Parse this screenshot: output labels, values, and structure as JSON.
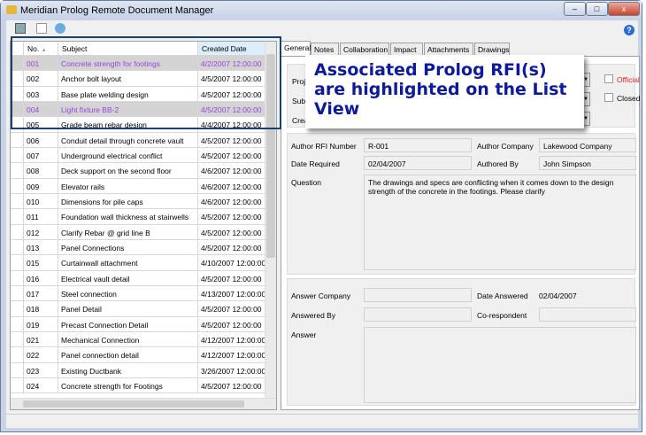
{
  "window": {
    "title": "Meridian Prolog Remote Document Manager",
    "minimize": "–",
    "maximize": "□",
    "close": "x"
  },
  "toolbar": {
    "icons": [
      "save-icon",
      "report-icon",
      "refresh-icon"
    ],
    "help": "?"
  },
  "list": {
    "columns": [
      "No.",
      "Subject",
      "Created Date"
    ],
    "rows": [
      {
        "no": "001",
        "subject": "Concrete strength for footings",
        "date": "4/2/2007 12:00:00",
        "highlighted": true
      },
      {
        "no": "002",
        "subject": "Anchor bolt layout",
        "date": "4/5/2007 12:00:00"
      },
      {
        "no": "003",
        "subject": "Base plate welding design",
        "date": "4/5/2007 12:00:00"
      },
      {
        "no": "004",
        "subject": "Light fixture BB-2",
        "date": "4/5/2007 12:00:00",
        "highlighted": true
      },
      {
        "no": "005",
        "subject": "Grade beam rebar design",
        "date": "4/4/2007 12:00:00"
      },
      {
        "no": "006",
        "subject": "Conduit detail through concrete vault",
        "date": "4/5/2007 12:00:00"
      },
      {
        "no": "007",
        "subject": "Underground electrical conflict",
        "date": "4/5/2007 12:00:00"
      },
      {
        "no": "008",
        "subject": "Deck support on the second floor",
        "date": "4/6/2007 12:00:00"
      },
      {
        "no": "009",
        "subject": "Elevator rails",
        "date": "4/6/2007 12:00:00"
      },
      {
        "no": "010",
        "subject": "Dimensions for pile caps",
        "date": "4/6/2007 12:00:00"
      },
      {
        "no": "011",
        "subject": "Foundation wall thickness at stairwells",
        "date": "4/5/2007 12:00:00"
      },
      {
        "no": "012",
        "subject": "Clarify Rebar @ grid line B",
        "date": "4/5/2007 12:00:00"
      },
      {
        "no": "013",
        "subject": "Panel Connections",
        "date": "4/5/2007 12:00:00"
      },
      {
        "no": "015",
        "subject": "Curtainwall attachment",
        "date": "4/10/2007 12:00:00"
      },
      {
        "no": "016",
        "subject": "Electrical vault detail",
        "date": "4/5/2007 12:00:00"
      },
      {
        "no": "017",
        "subject": "Steel connection",
        "date": "4/13/2007 12:00:00"
      },
      {
        "no": "018",
        "subject": "Panel Detail",
        "date": "4/5/2007 12:00:00"
      },
      {
        "no": "019",
        "subject": "Precast Connection Detail",
        "date": "4/5/2007 12:00:00"
      },
      {
        "no": "021",
        "subject": "Mechanical Connection",
        "date": "4/12/2007 12:00:00"
      },
      {
        "no": "022",
        "subject": "Panel connection detail",
        "date": "4/12/2007 12:00:00"
      },
      {
        "no": "023",
        "subject": "Existing Ductbank",
        "date": "3/26/2007 12:00:00"
      },
      {
        "no": "024",
        "subject": "Concrete strength for Footings",
        "date": "4/5/2007 12:00:00"
      }
    ]
  },
  "tabs": [
    "General",
    "Notes",
    "Collaboration",
    "Impact",
    "Attachments",
    "Drawings"
  ],
  "general": {
    "project_label": "Proje",
    "subject_label": "Subj",
    "created_label": "Crea",
    "official": "Official",
    "closed": "Closed",
    "author_rfi_number_label": "Author RFI Number",
    "author_rfi_number": "R-001",
    "author_company_label": "Author Company",
    "author_company": "Lakewood Company",
    "date_required_label": "Date Required",
    "date_required": "02/04/2007",
    "authored_by_label": "Authored By",
    "authored_by": "John Simpson",
    "question_label": "Question",
    "question": "The drawings and specs are conflicting when it comes down to the design strength of the concrete in the footings.  Please clarify",
    "answer_company_label": "Answer Company",
    "answer_company": "",
    "date_answered_label": "Date Answered",
    "date_answered": "02/04/2007",
    "answered_by_label": "Answered By",
    "answered_by": "",
    "corespondent_label": "Co-respondent",
    "corespondent": "",
    "answer_label": "Answer",
    "answer": ""
  },
  "callout": "Associated Prolog RFI(s) are highlighted on the List View",
  "colors": {
    "highlight_row": "#d3d3d3",
    "highlight_text": "#9944dd",
    "callout_text": "#0d1a9c",
    "official": "#e02020"
  }
}
